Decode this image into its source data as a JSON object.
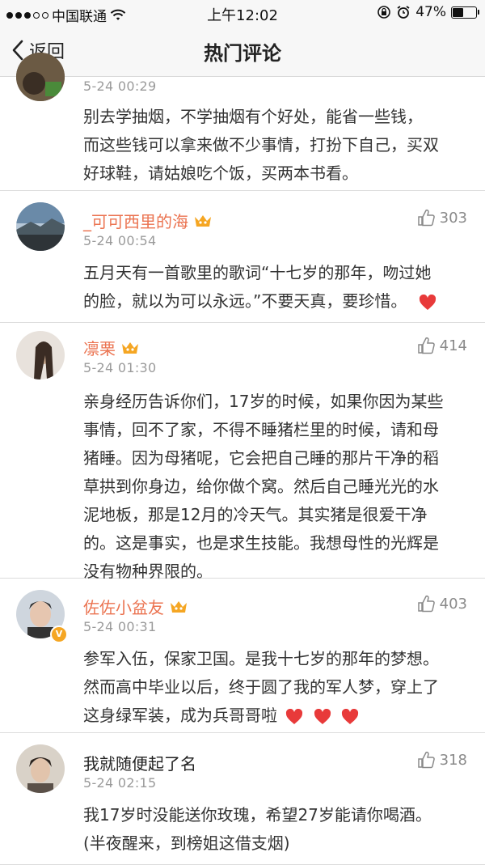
{
  "status_bar": {
    "carrier": "中国联通",
    "time": "上午12:02",
    "battery": "47%",
    "signal_dots_filled": 3,
    "signal_dots_total": 5
  },
  "nav": {
    "back_label": "返回",
    "title": "热门评论"
  },
  "comments": [
    {
      "user": "",
      "time": "5-24 00:29",
      "likes": "",
      "text_lines": [
        "别去学抽烟，不学抽烟有个好处，能省一些钱，",
        "而这些钱可以拿来做不少事情，打扮下自己，买双",
        "好球鞋，请姑娘吃个饭，买两本书看。"
      ]
    },
    {
      "user": "_可可西里的海",
      "time": "5-24 00:54",
      "likes": "303",
      "text_lines": [
        "五月天有一首歌里的歌词“十七岁的那年，吻过她",
        "的脸，就以为可以永远。”不要天真，要珍惜。"
      ]
    },
    {
      "user": "凛栗",
      "time": "5-24 01:30",
      "likes": "414",
      "text_lines": [
        "亲身经历告诉你们，17岁的时候，如果你因为某些",
        "事情，回不了家，不得不睡猪栏里的时候，请和母",
        "猪睡。因为母猪呢，它会把自己睡的那片干净的稻",
        "草拱到你身边，给你做个窝。然后自己睡光光的水",
        "泥地板，那是12月的冷天气。其实猪是很爱干净",
        "的。这是事实，也是求生技能。我想母性的光辉是",
        "没有物种界限的。"
      ]
    },
    {
      "user": "佐佐小盆友",
      "time": "5-24 00:31",
      "likes": "403",
      "text_lines": [
        "参军入伍，保家卫国。是我十七岁的那年的梦想。",
        "然而高中毕业以后，终于圆了我的军人梦，穿上了",
        "这身绿军装，成为兵哥哥啦"
      ]
    },
    {
      "user": "我就随便起了名",
      "time": "5-24 02:15",
      "likes": "318",
      "text_lines": [
        "我17岁时没能送你玫瑰，希望27岁能请你喝酒。",
        "(半夜醒来，到榜姐这借支烟)"
      ]
    }
  ],
  "colors": {
    "accent_orange": "#eb7350",
    "heart_red": "#e83a3a",
    "vip_gold": "#f5a623"
  }
}
